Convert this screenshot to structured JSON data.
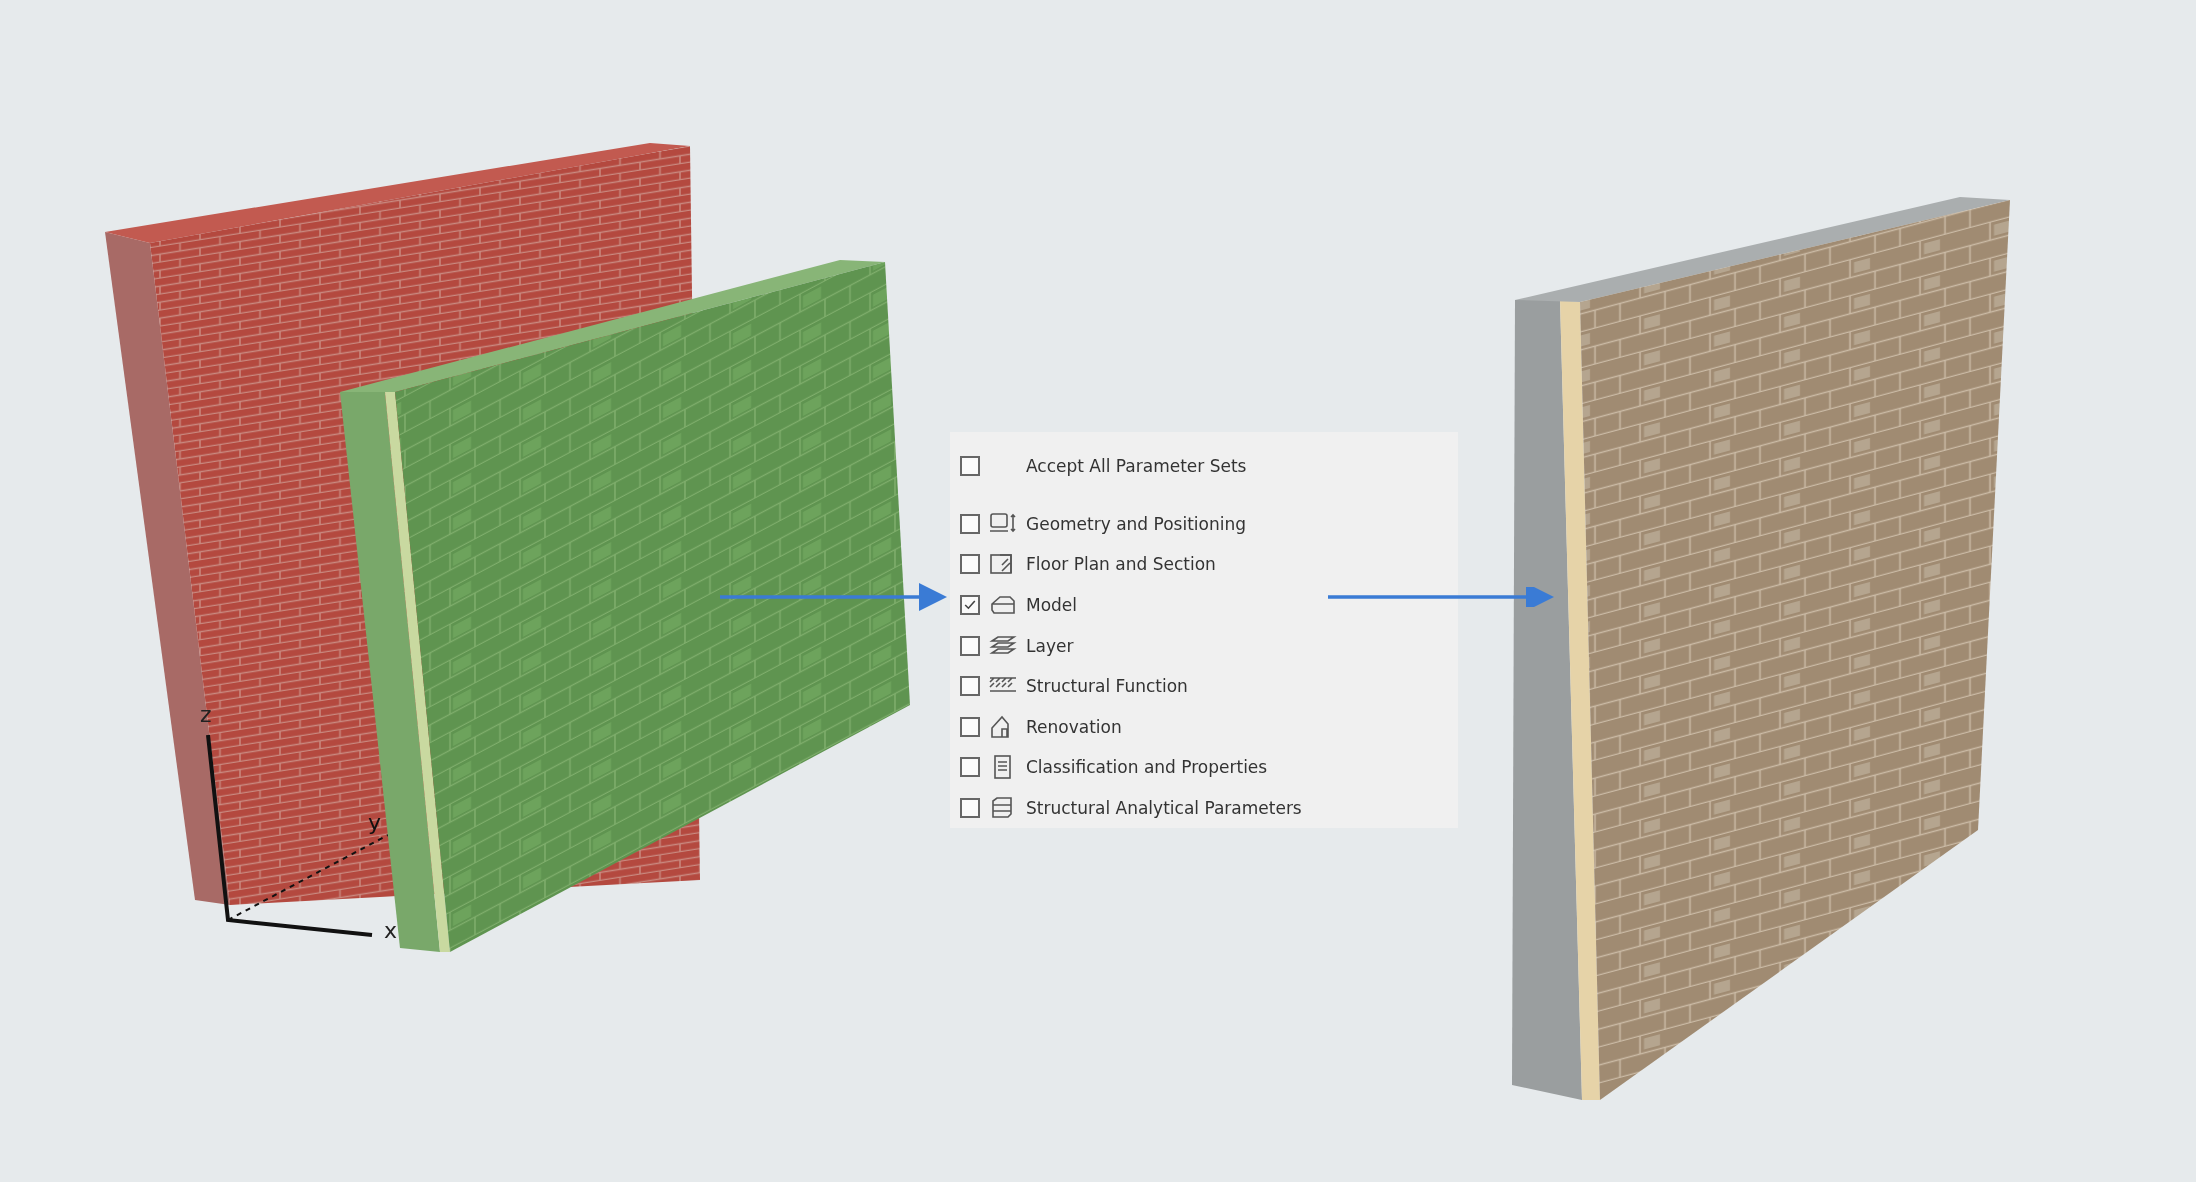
{
  "axes": {
    "x": "x",
    "y": "y",
    "z": "z"
  },
  "panel": {
    "accept_all": {
      "label": "Accept All Parameter Sets",
      "checked": false
    },
    "items": [
      {
        "label": "Geometry and Positioning",
        "checked": false
      },
      {
        "label": "Floor Plan and Section",
        "checked": false
      },
      {
        "label": "Model",
        "checked": true
      },
      {
        "label": "Layer",
        "checked": false
      },
      {
        "label": "Structural Function",
        "checked": false
      },
      {
        "label": "Renovation",
        "checked": false
      },
      {
        "label": "Classification and Properties",
        "checked": false
      },
      {
        "label": "Structural Analytical Parameters",
        "checked": false
      }
    ]
  }
}
